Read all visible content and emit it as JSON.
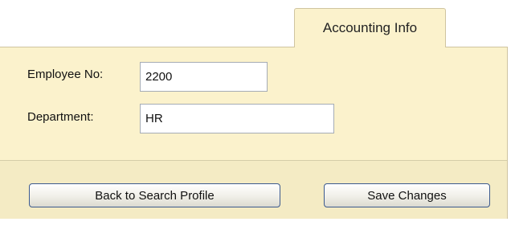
{
  "tabs": [
    {
      "label": "Accounting Info",
      "active": true
    }
  ],
  "form": {
    "employee_no": {
      "label": "Employee No:",
      "value": "2200"
    },
    "department": {
      "label": "Department:",
      "value": "HR"
    }
  },
  "actions": {
    "back_label": "Back to Search Profile",
    "save_label": "Save Changes"
  },
  "colors": {
    "panel_background": "#fbf2cc",
    "footer_background": "#f4ebc4",
    "button_border": "#3c5a8e"
  }
}
